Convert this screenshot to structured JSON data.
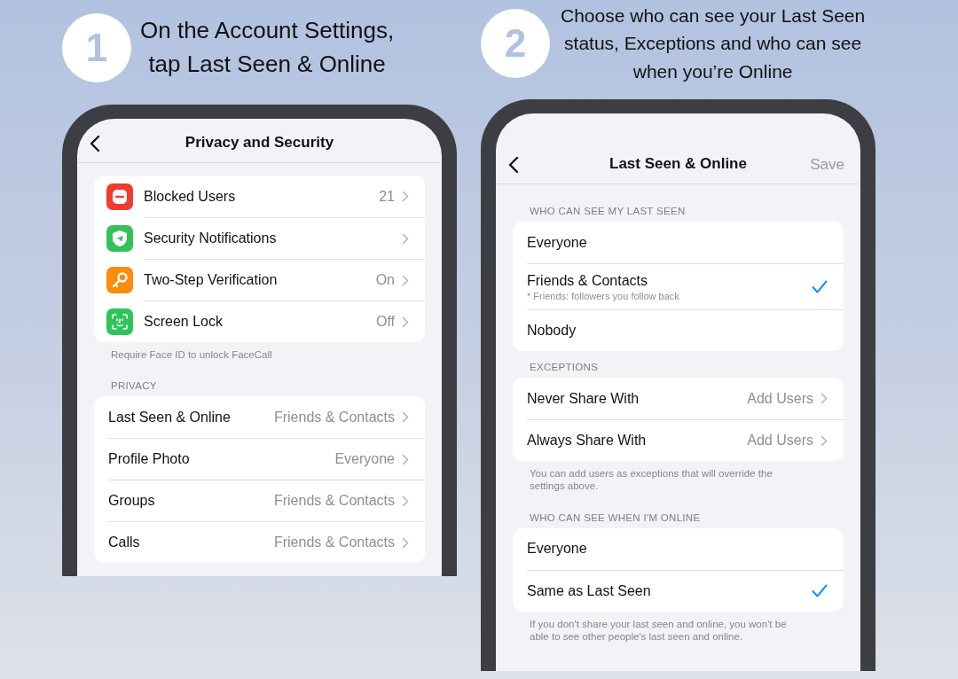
{
  "steps": [
    {
      "number": "1",
      "caption_lines": [
        "On the Account Settings,",
        "tap Last Seen & Online"
      ],
      "screen": {
        "title": "Privacy and Security",
        "sections": [
          {
            "kind": "icon-list",
            "rows": [
              {
                "kind": "link",
                "label": "Blocked Users",
                "value": "21"
              },
              {
                "kind": "link",
                "label": "Security Notifications"
              },
              {
                "kind": "link",
                "label": "Two-Step Verification",
                "value": "On"
              },
              {
                "kind": "link",
                "label": "Screen Lock",
                "value": "Off"
              }
            ],
            "footer": "Require Face ID to unlock FaceCall"
          },
          {
            "kind": "list",
            "header": "PRIVACY",
            "rows": [
              {
                "kind": "link",
                "label": "Last Seen & Online",
                "value": "Friends & Contacts"
              },
              {
                "kind": "link",
                "label": "Profile Photo",
                "value": "Everyone"
              },
              {
                "kind": "link",
                "label": "Groups",
                "value": "Friends & Contacts"
              },
              {
                "kind": "link",
                "label": "Calls",
                "value": "Friends & Contacts"
              }
            ]
          }
        ]
      }
    },
    {
      "number": "2",
      "caption_lines": [
        "Choose who can see your Last Seen",
        "status, Exceptions and who can see",
        "when you’re Online"
      ],
      "screen": {
        "title": "Last Seen & Online",
        "action": {
          "label": "Save",
          "disabled": true
        },
        "sections": [
          {
            "kind": "list",
            "header": "WHO CAN SEE MY LAST SEEN",
            "rows": [
              {
                "kind": "option",
                "label": "Everyone",
                "selected": false
              },
              {
                "kind": "option",
                "label": "Friends & Contacts",
                "subtitle": "* Friends: followers you follow back",
                "selected": true
              },
              {
                "kind": "option",
                "label": "Nobody",
                "selected": false
              }
            ]
          },
          {
            "kind": "list",
            "header": "EXCEPTIONS",
            "rows": [
              {
                "kind": "link",
                "label": "Never Share With",
                "value": "Add Users"
              },
              {
                "kind": "link",
                "label": "Always Share With",
                "value": "Add Users"
              }
            ],
            "footer": "You can add users as exceptions that will override the settings above."
          },
          {
            "kind": "list",
            "header": "WHO CAN SEE WHEN I'M ONLINE",
            "rows": [
              {
                "kind": "option",
                "label": "Everyone",
                "selected": false
              },
              {
                "kind": "option",
                "label": "Same as Last Seen",
                "selected": true
              }
            ],
            "footer": "If you don't share your last seen and online, you won't be able to see other people's last seen and online."
          }
        ]
      }
    }
  ]
}
